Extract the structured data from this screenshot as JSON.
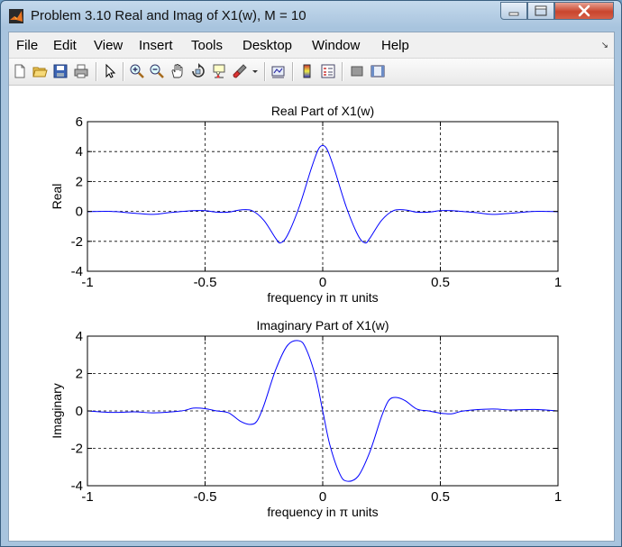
{
  "window": {
    "title": "Problem 3.10 Real and Imag of X1(w), M = 10"
  },
  "menu": [
    "File",
    "Edit",
    "View",
    "Insert",
    "Tools",
    "Desktop",
    "Window",
    "Help"
  ],
  "menu_overflow": "↘",
  "toolbar": [
    "new-figure-icon",
    "open-file-icon",
    "save-icon",
    "print-icon",
    "pointer-icon",
    "zoom-in-icon",
    "zoom-out-icon",
    "pan-icon",
    "rotate-3d-icon",
    "data-cursor-icon",
    "brush-icon",
    "dropdown-arrow-icon",
    "link-plot-icon",
    "colorbar-icon",
    "legend-icon",
    "hide-plot-tools-icon",
    "show-plot-tools-icon"
  ],
  "chart_data": [
    {
      "type": "line",
      "title": "Real Part of X1(w)",
      "xlabel": "frequency in π units",
      "ylabel": "Real",
      "xlim": [
        -1,
        1
      ],
      "ylim": [
        -4,
        6
      ],
      "xticks": [
        -1,
        -0.5,
        0,
        0.5,
        1
      ],
      "xtick_labels": [
        "-1",
        "-0.5",
        "0",
        "0.5",
        "1"
      ],
      "yticks": [
        -4,
        -2,
        0,
        2,
        4,
        6
      ],
      "ytick_labels": [
        "-4",
        "-2",
        "0",
        "2",
        "4",
        "6"
      ],
      "grid": true,
      "line_color": "#0000ff",
      "x": [
        -1,
        -0.9,
        -0.8,
        -0.72,
        -0.65,
        -0.55,
        -0.5,
        -0.45,
        -0.4,
        -0.35,
        -0.3,
        -0.25,
        -0.2,
        -0.18,
        -0.15,
        -0.1,
        -0.05,
        -0.02,
        0,
        0.02,
        0.05,
        0.1,
        0.15,
        0.18,
        0.2,
        0.25,
        0.3,
        0.35,
        0.4,
        0.45,
        0.5,
        0.55,
        0.65,
        0.72,
        0.8,
        0.9,
        1
      ],
      "y": [
        -0.02,
        0.0,
        -0.12,
        -0.2,
        -0.08,
        0.05,
        0.05,
        -0.05,
        -0.05,
        0.1,
        0.05,
        -0.6,
        -1.8,
        -2.1,
        -1.6,
        0.3,
        2.8,
        4.1,
        4.4,
        4.1,
        2.8,
        0.3,
        -1.6,
        -2.1,
        -1.8,
        -0.6,
        0.05,
        0.1,
        -0.05,
        -0.05,
        0.05,
        0.05,
        -0.08,
        -0.2,
        -0.12,
        0.0,
        -0.02
      ]
    },
    {
      "type": "line",
      "title": "Imaginary Part of X1(w)",
      "xlabel": "frequency in π units",
      "ylabel": "Imaginary",
      "xlim": [
        -1,
        1
      ],
      "ylim": [
        -4,
        4
      ],
      "xticks": [
        -1,
        -0.5,
        0,
        0.5,
        1
      ],
      "xtick_labels": [
        "-1",
        "-0.5",
        "0",
        "0.5",
        "1"
      ],
      "yticks": [
        -4,
        -2,
        0,
        2,
        4
      ],
      "ytick_labels": [
        "-4",
        "-2",
        "0",
        "2",
        "4"
      ],
      "grid": true,
      "line_color": "#0000ff",
      "x": [
        -1,
        -0.9,
        -0.8,
        -0.72,
        -0.6,
        -0.55,
        -0.5,
        -0.45,
        -0.4,
        -0.35,
        -0.31,
        -0.28,
        -0.25,
        -0.2,
        -0.15,
        -0.1,
        -0.07,
        -0.03,
        0,
        0.03,
        0.07,
        0.1,
        0.15,
        0.2,
        0.25,
        0.28,
        0.31,
        0.35,
        0.4,
        0.45,
        0.5,
        0.55,
        0.6,
        0.72,
        0.8,
        0.9,
        1
      ],
      "y": [
        0.0,
        -0.08,
        -0.05,
        -0.1,
        0.0,
        0.15,
        0.12,
        0.0,
        -0.1,
        -0.55,
        -0.72,
        -0.55,
        0.3,
        2.2,
        3.5,
        3.75,
        3.3,
        1.8,
        0.0,
        -1.8,
        -3.3,
        -3.75,
        -3.5,
        -2.2,
        -0.3,
        0.55,
        0.72,
        0.55,
        0.1,
        0.0,
        -0.12,
        -0.15,
        0.0,
        0.1,
        0.05,
        0.08,
        0.0
      ]
    }
  ]
}
